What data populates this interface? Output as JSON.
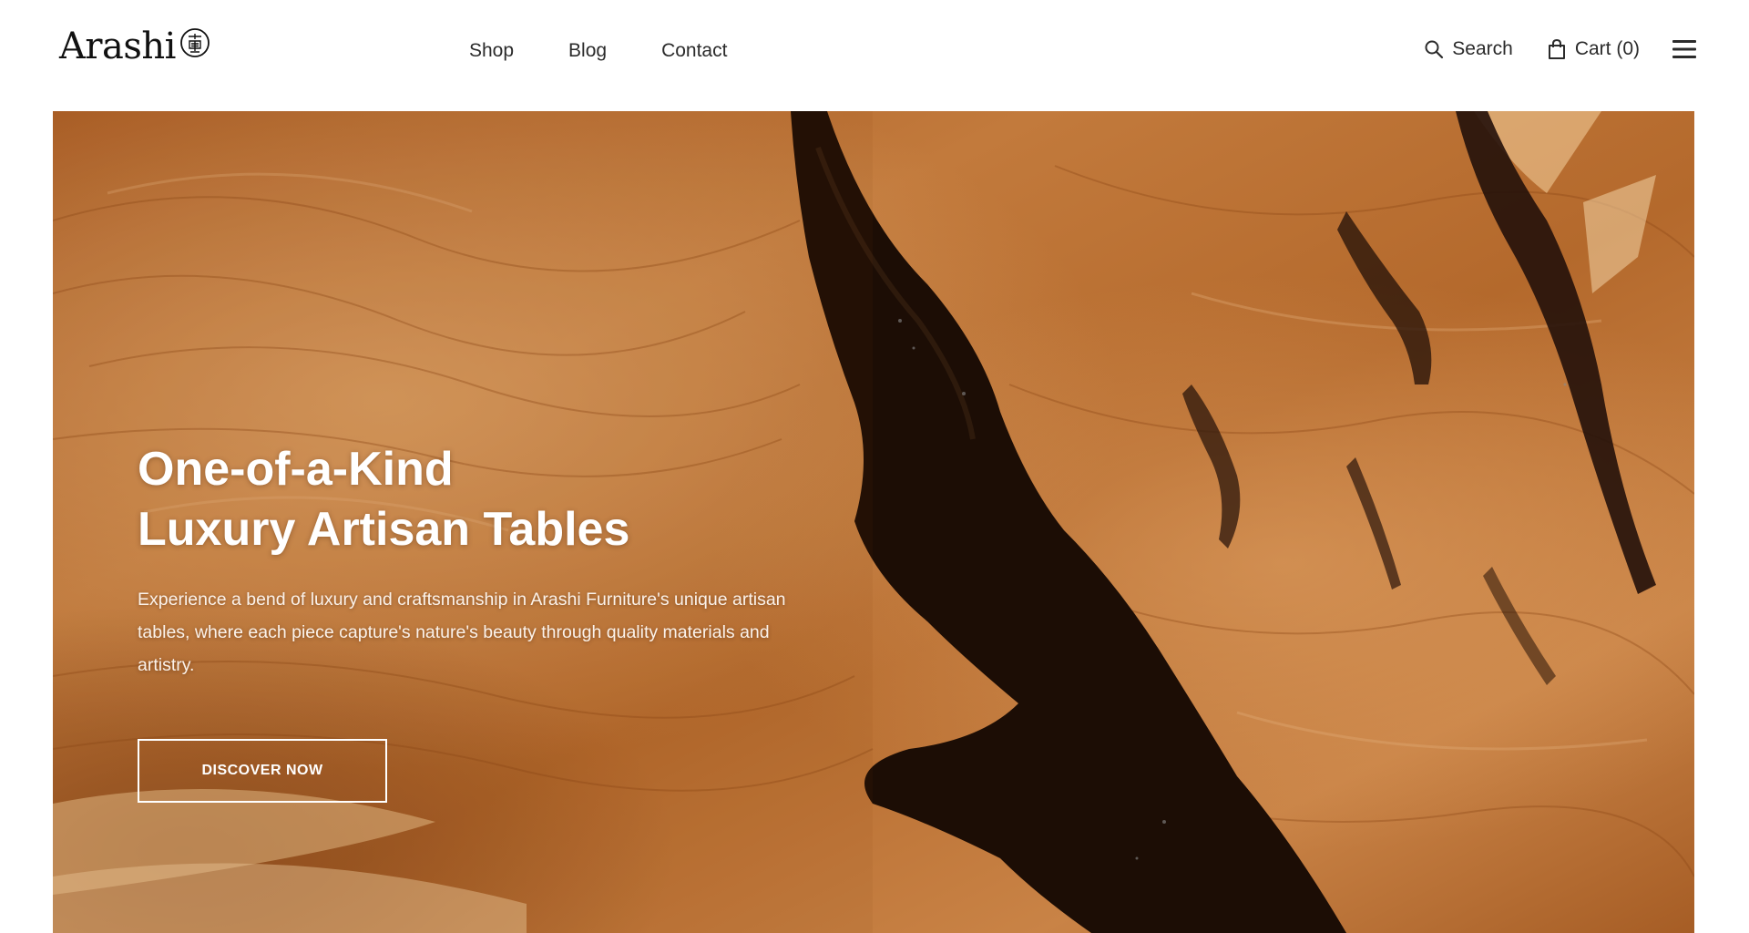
{
  "brand": {
    "name": "Arashi"
  },
  "nav": {
    "items": [
      {
        "label": "Shop"
      },
      {
        "label": "Blog"
      },
      {
        "label": "Contact"
      }
    ]
  },
  "utility": {
    "search_label": "Search",
    "search_icon": "search-icon",
    "cart_label": "Cart (0)",
    "cart_icon": "bag-icon",
    "menu_icon": "hamburger-menu-icon"
  },
  "hero": {
    "title_line1": "One-of-a-Kind",
    "title_line2": "Luxury Artisan Tables",
    "description": "Experience a bend of luxury and craftsmanship in Arashi Furniture's unique artisan tables, where each piece capture's nature's beauty through quality materials and artistry.",
    "cta_label": "DISCOVER NOW"
  },
  "colors": {
    "text_dark": "#2b2b2b",
    "wood_base": "#b86a2a",
    "wood_dark": "#1a0d06",
    "cta_border": "#ffffff"
  }
}
